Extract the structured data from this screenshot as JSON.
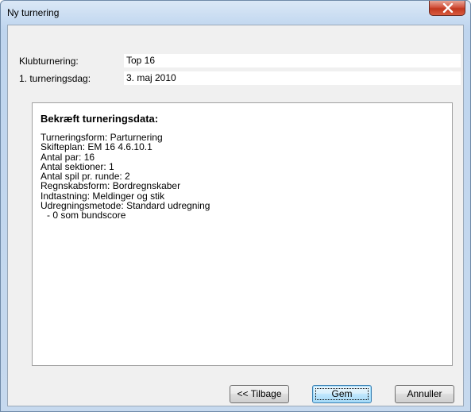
{
  "window": {
    "title": "Ny turnering",
    "close_icon": "close-icon"
  },
  "fields": {
    "club_label": "Klubturnering:",
    "club_value": "Top 16",
    "date_label": "1. turneringsdag:",
    "date_value": "3. maj 2010"
  },
  "confirm": {
    "heading": "Bekræft turneringsdata:",
    "lines": [
      "Turneringsform: Parturnering",
      "Skifteplan: EM 16 4.6.10.1",
      "Antal par: 16",
      "Antal sektioner: 1",
      "Antal spil pr. runde: 2",
      "Regnskabsform: Bordregnskaber",
      "Indtastning: Meldinger og stik",
      "Udregningsmetode: Standard udregning"
    ],
    "sub_line": "- 0 som bundscore"
  },
  "buttons": {
    "back": "<< Tilbage",
    "save": "Gem",
    "cancel": "Annuller"
  },
  "colors": {
    "close_button": "#c7422a",
    "default_button_border": "#3c7fb1"
  }
}
